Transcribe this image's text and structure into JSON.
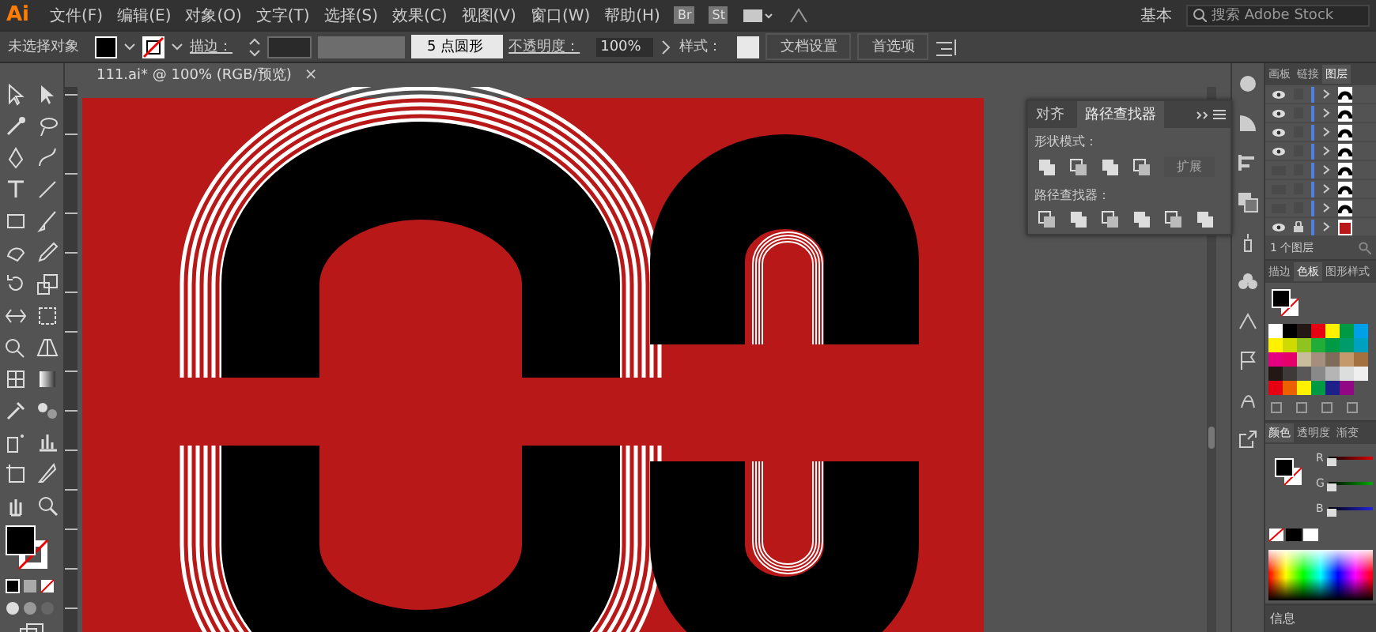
{
  "menu_bar": {
    "logo": "Ai",
    "items": [
      "文件(F)",
      "编辑(E)",
      "对象(O)",
      "文字(T)",
      "选择(S)",
      "效果(C)",
      "视图(V)",
      "窗口(W)",
      "帮助(H)"
    ],
    "badges": [
      "Br",
      "St"
    ],
    "workspace": "基本",
    "search": {
      "placeholder": "搜索 Adobe Stock"
    }
  },
  "control_bar": {
    "selection": "未选择对象",
    "stroke_label": "描边：",
    "brush": "5 点圆形",
    "opacity_label": "不透明度：",
    "opacity": "100%",
    "style_label": "样式：",
    "buttons": [
      "文档设置",
      "首选项"
    ]
  },
  "document_tab": {
    "title": "111.ai* @ 100% (RGB/预览)",
    "close": "×"
  },
  "pathfinder_panel": {
    "tabs": [
      {
        "label": "对齐",
        "selected": false
      },
      {
        "label": "路径查找器",
        "selected": true
      }
    ],
    "shape_modes_label": "形状模式：",
    "expand_button": {
      "label": "扩展",
      "disabled": true
    },
    "pathfinders_label": "路径查找器："
  },
  "layers_panel": {
    "tabs": [
      {
        "label": "画板",
        "selected": false
      },
      {
        "label": "链接",
        "selected": false
      },
      {
        "label": "图层",
        "selected": true
      }
    ],
    "layers": [
      {
        "visible": true,
        "locked": false
      },
      {
        "visible": true,
        "locked": false
      },
      {
        "visible": true,
        "locked": false
      },
      {
        "visible": true,
        "locked": false
      },
      {
        "visible": false,
        "locked": false
      },
      {
        "visible": false,
        "locked": false
      },
      {
        "visible": false,
        "locked": false
      },
      {
        "visible": true,
        "locked": true
      }
    ],
    "footer": "1 个图层"
  },
  "swatches_panel": {
    "tabs": [
      {
        "label": "描边",
        "selected": false
      },
      {
        "label": "色板",
        "selected": true
      },
      {
        "label": "图形样式",
        "selected": false
      }
    ],
    "swatches": [
      {
        "color": "#ffffff"
      },
      {
        "color": "#000000"
      },
      {
        "color": "#231815"
      },
      {
        "color": "#e60012"
      },
      {
        "color": "#fff100"
      },
      {
        "color": "#009944"
      },
      {
        "color": "#00a0e9"
      },
      {
        "color": "#fff100"
      },
      {
        "color": "#cfdb00"
      },
      {
        "color": "#8fc31f"
      },
      {
        "color": "#22ac38"
      },
      {
        "color": "#009944"
      },
      {
        "color": "#009b6b"
      },
      {
        "color": "#00a0c1"
      },
      {
        "color": "#e4007f"
      },
      {
        "color": "#e5006a"
      },
      {
        "color": "#c9bc9c"
      },
      {
        "color": "#a58f7c"
      },
      {
        "color": "#7f6b5a"
      },
      {
        "color": "#c49a6c"
      },
      {
        "color": "#a3703f"
      },
      {
        "color": "#231815"
      },
      {
        "color": "#3e3a39"
      },
      {
        "color": "#595757"
      },
      {
        "color": "#898989"
      },
      {
        "color": "#b5b5b6"
      },
      {
        "color": "#dcdddd"
      },
      {
        "color": "#efefef"
      },
      {
        "color": "#e60012"
      },
      {
        "color": "#eb6100"
      },
      {
        "color": "#fff100"
      },
      {
        "color": "#009944"
      },
      {
        "color": "#1d2088"
      },
      {
        "color": "#920783"
      }
    ]
  },
  "color_panel": {
    "tabs": [
      {
        "label": "颜色",
        "selected": true
      },
      {
        "label": "透明度",
        "selected": false
      },
      {
        "label": "渐变",
        "selected": false
      }
    ],
    "channels": [
      {
        "label": "R",
        "level": 0
      },
      {
        "label": "G",
        "level": 0
      },
      {
        "label": "B",
        "level": 0
      }
    ]
  },
  "collapsed_panel": {
    "label": "信息"
  }
}
